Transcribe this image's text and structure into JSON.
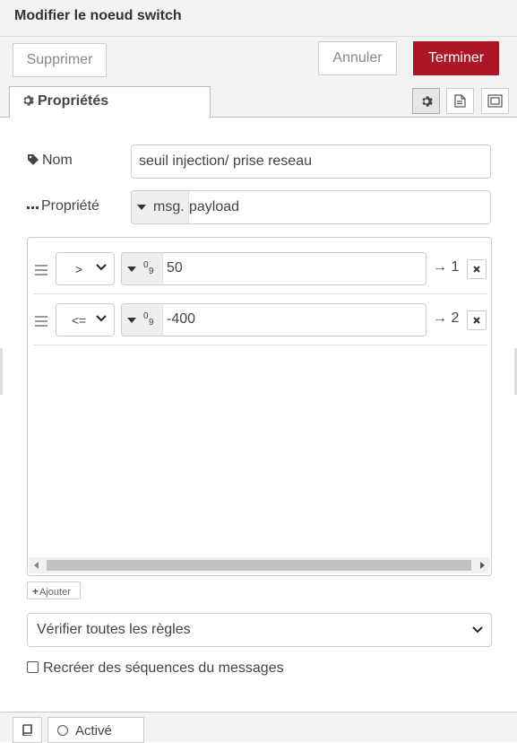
{
  "header": {
    "title": "Modifier le noeud switch"
  },
  "toolbar": {
    "delete_label": "Supprimer",
    "cancel_label": "Annuler",
    "done_label": "Terminer"
  },
  "tabs": {
    "properties_label": "Propriétés"
  },
  "form": {
    "name_label": "Nom",
    "name_value": "seuil injection/ prise reseau",
    "property_label": "Propriété",
    "property_type": "msg.",
    "property_value": "payload"
  },
  "rules": [
    {
      "operator": ">",
      "value_type": "number",
      "value": "50",
      "output": "→ 1"
    },
    {
      "operator": "<=",
      "value_type": "number",
      "value": "-400",
      "output": "→ 2"
    }
  ],
  "add_label": "Ajouter",
  "check_mode": "Vérifier toutes les règles",
  "recreate_label": "Recréer des séquences du messages",
  "footer": {
    "status_label": "Activé"
  },
  "colors": {
    "primary": "#ad1625",
    "header_bg": "#f3f3f3"
  }
}
